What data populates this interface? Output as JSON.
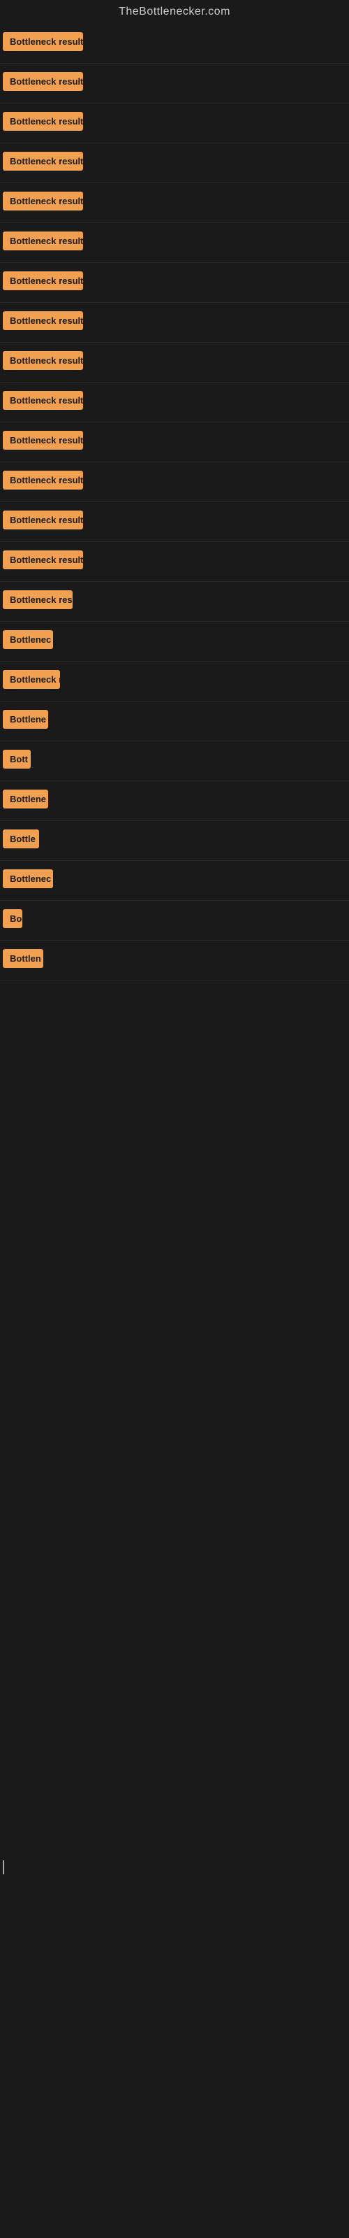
{
  "site": {
    "title": "TheBottlenecker.com"
  },
  "items": [
    {
      "label": "Bottleneck result",
      "badge_width": 115
    },
    {
      "label": "Bottleneck result",
      "badge_width": 115
    },
    {
      "label": "Bottleneck result",
      "badge_width": 115
    },
    {
      "label": "Bottleneck result",
      "badge_width": 115
    },
    {
      "label": "Bottleneck result",
      "badge_width": 115
    },
    {
      "label": "Bottleneck result",
      "badge_width": 115
    },
    {
      "label": "Bottleneck result",
      "badge_width": 115
    },
    {
      "label": "Bottleneck result",
      "badge_width": 115
    },
    {
      "label": "Bottleneck result",
      "badge_width": 115
    },
    {
      "label": "Bottleneck result",
      "badge_width": 115
    },
    {
      "label": "Bottleneck result",
      "badge_width": 115
    },
    {
      "label": "Bottleneck result",
      "badge_width": 115
    },
    {
      "label": "Bottleneck result",
      "badge_width": 115
    },
    {
      "label": "Bottleneck result",
      "badge_width": 115
    },
    {
      "label": "Bottleneck res",
      "badge_width": 100
    },
    {
      "label": "Bottlenec",
      "badge_width": 72
    },
    {
      "label": "Bottleneck r",
      "badge_width": 82
    },
    {
      "label": "Bottlene",
      "badge_width": 65
    },
    {
      "label": "Bott",
      "badge_width": 40
    },
    {
      "label": "Bottlene",
      "badge_width": 65
    },
    {
      "label": "Bottle",
      "badge_width": 52
    },
    {
      "label": "Bottlenec",
      "badge_width": 72
    },
    {
      "label": "Bo",
      "badge_width": 28
    },
    {
      "label": "Bottlen",
      "badge_width": 58
    }
  ]
}
